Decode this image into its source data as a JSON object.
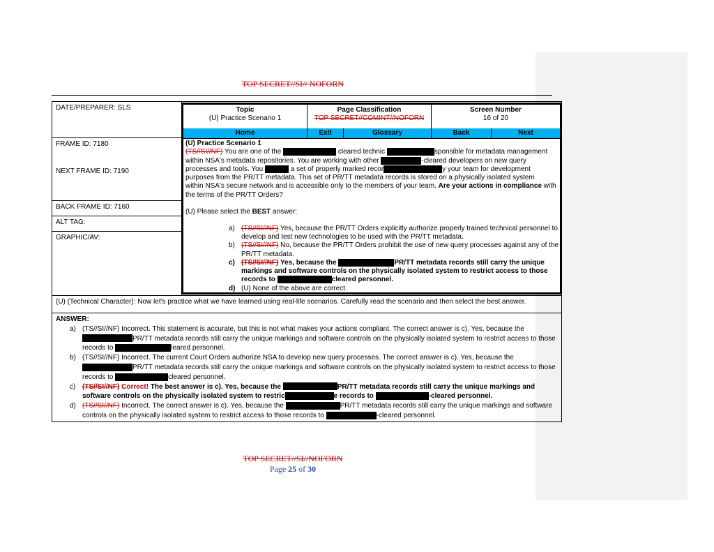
{
  "classification": {
    "top": "TOP SECRET//SI// NOFORN",
    "bottom": "TOP SECRET//SI//NOFORN"
  },
  "page": {
    "label": "Page",
    "current": "25",
    "of": "of",
    "total": "30"
  },
  "left_cells": {
    "date_preparer": "DATE/PREPARER: SLS",
    "frame_id": "FRAME ID: 7180",
    "next_frame": "NEXT FRAME ID: 7190",
    "back_frame": "BACK FRAME ID: 7160",
    "alt_tag": "ALT TAG:",
    "graphic": "GRAPHIC/AV:"
  },
  "header": {
    "topic_label": "Topic",
    "topic_value": "(U) Practice Scenario 1",
    "class_label": "Page Classification",
    "class_value": "TOP SECRET//COMINT//NOFORN",
    "screen_label": "Screen Number",
    "screen_value": "16 of 20"
  },
  "nav": {
    "home": "Home",
    "exit": "Exit",
    "glossary": "Glossary",
    "back": "Back",
    "next": "Next"
  },
  "scenario": {
    "title": "(U) Practice Scenario 1",
    "marking": "(TS//SI//NF)",
    "p1a": " You are one of the ",
    "p1b": " cleared technic",
    "p1c": "sponsible for metadata management",
    "p2a": "within NSA's metadata repositories. You are working with other ",
    "p2b": "-cleared developers on new query",
    "p3a": "processes and tools. You ",
    "p3b": " a set of properly marked recor",
    "p3c": "y your team for development",
    "p4": "purposes from the PR/TT metadata. This set of PR/TT metadata records is stored on a physically isolated system",
    "p5": "within NSA's secure network and is accessible only to the members of your team.",
    "question": "Are your actions in compliance",
    "question_end": " with the terms of the PR/TT Orders?",
    "select_a": "(U) Please select the ",
    "select_best": "BEST",
    "select_b": " answer:"
  },
  "options": [
    {
      "letter": "a)",
      "marking": "(TS//SI//NF)",
      "text": " Yes, because the PR/TT Orders explicitly authorize properly trained technical personnel to develop and test new technologies to be used with the PR/TT metadata."
    },
    {
      "letter": "b)",
      "marking": "(TS//SI//NF)",
      "text": " No, because the PR/TT Orders prohibit the use of new query processes against any of the PR/TT metadata."
    },
    {
      "letter": "c)",
      "marking": "(TS//SI//NF)",
      "text_a": " Yes, because the ",
      "text_b": "PR/TT metadata records still carry the unique markings and software controls on the physically isolated system to restrict access to those records to ",
      "text_c": "cleared personnel."
    },
    {
      "letter": "d)",
      "marking": "",
      "text": "(U) None of the above are correct."
    }
  ],
  "technical": "(U) (Technical Character): Now let's practice what we have learned using real-life scenarios. Carefully read the scenario and then select the best answer.",
  "answer": {
    "title": "ANSWER:",
    "items": [
      {
        "letter": "a)",
        "marking": "(TS//SI//NF)",
        "a": " Incorrect. This statement is accurate, but this is not what makes your actions compliant. The correct answer is c). Yes, because the ",
        "b": "PR/TT metadata records still carry the unique markings and software controls on the physically isolated system to restrict access to those records to ",
        "c": "leared personnel."
      },
      {
        "letter": "b)",
        "marking": "(TS//SI//NF)",
        "a": " Incorrect. The current Court Orders authorize NSA to develop new query processes. The correct answer is c). Yes, because the ",
        "b": "PR/TT metadata records still carry the unique markings and software controls on the physically isolated system to restrict access to those records to ",
        "c": "cleared personnel."
      },
      {
        "letter": "c)",
        "marking": "(TS//SI//NF)",
        "correct": " Correct!",
        "a": " The best answer is c). Yes, because the ",
        "b": "PR/TT metadata records still carry the unique markings and software controls on the physically isolated system to restric",
        "c": "e records to ",
        "d": "-cleared personnel."
      },
      {
        "letter": "d)",
        "marking": "(TS//SI//NF)",
        "a": " Incorrect. The correct answer is c). Yes, because the ",
        "b": "PR/TT metadata records still carry the unique markings and software controls on the physically isolated system to restrict access to those records to ",
        "c": "-cleared personnel."
      }
    ]
  }
}
